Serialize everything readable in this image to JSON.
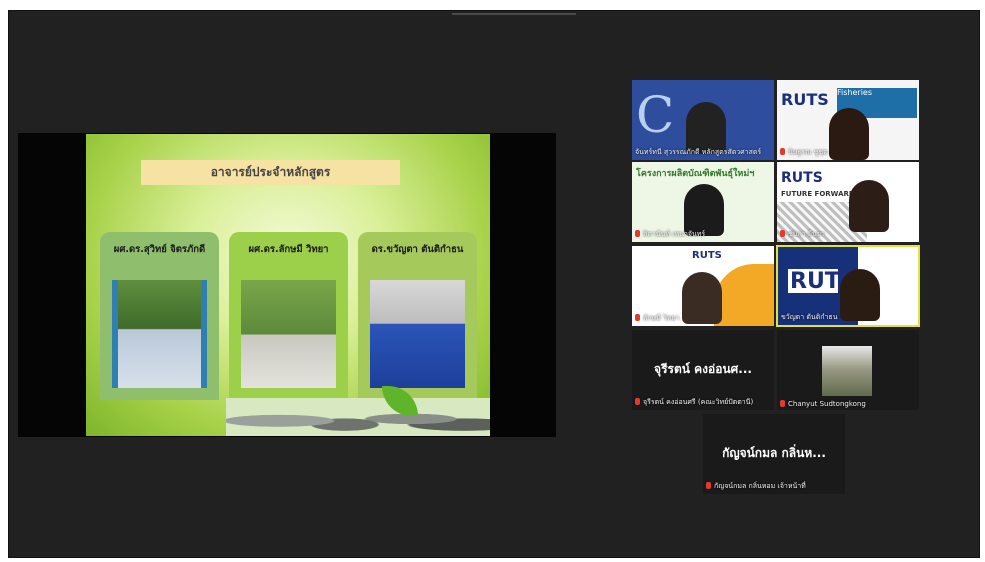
{
  "slide": {
    "title": "อาจารย์ประจำหลักสูตร",
    "people": [
      {
        "name": "ผศ.ดร.สุวิทย์ จิตรภักดี"
      },
      {
        "name": "ผศ.ดร.ลักษมี วิทยา"
      },
      {
        "name": "ดร.ขวัญตา ตันติกำธน"
      }
    ]
  },
  "gallery": {
    "tiles": [
      {
        "label": "จันทร์ทนี สุวรรณภักดี หลักสูตรสัตวศาสตร์",
        "banner": "C",
        "muted": false
      },
      {
        "label": "นิษฐรณ ชูชุด",
        "banner": "RUTS",
        "banner_text": "Fisheries",
        "muted": true
      },
      {
        "label": "สิตานันท์ เหนาจันทร์",
        "banner": "โครงการผลิตบัณฑิตพันธุ์ใหม่ฯ",
        "muted": true
      },
      {
        "label": "ชนิกา ยืนยา",
        "banner": "RUTS",
        "banner_text": "FUTURE FORWARD",
        "muted": true
      },
      {
        "label": "ลักษมี วิทยา",
        "banner": "RUTS",
        "muted": true
      },
      {
        "label": "ขวัญตา ตันติกำธน",
        "banner": "RUTS",
        "muted": false,
        "active": true
      },
      {
        "label": "จุรีรตน์ คงอ่อนศรี (คณะวิทย์ปัตตานี)",
        "name_display": "จุรีรตน์ คงอ่อนศ...",
        "muted": true
      },
      {
        "label": "Chanyut Sudtongkong",
        "muted": true
      },
      {
        "label": "กัญจน์กมล กลิ่นหอม เจ้าหน้าที่",
        "name_display": "กัญจน์กมล กลิ่นห...",
        "muted": true
      }
    ]
  },
  "colors": {
    "background": "#212121",
    "active_border": "#e0e040",
    "mic_muted": "#e23b2e"
  }
}
